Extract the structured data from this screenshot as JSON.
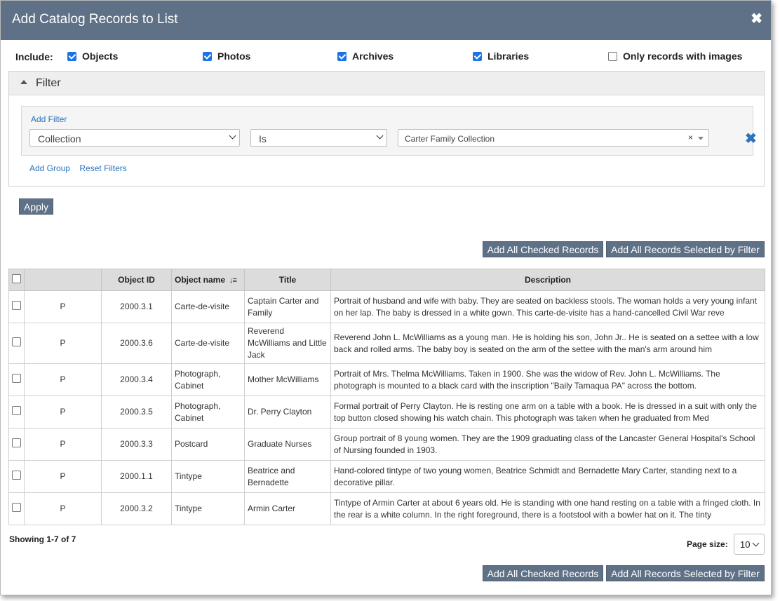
{
  "dialog": {
    "title": "Add Catalog Records to List"
  },
  "include": {
    "label": "Include:",
    "options": [
      {
        "label": "Objects",
        "checked": true
      },
      {
        "label": "Photos",
        "checked": true
      },
      {
        "label": "Archives",
        "checked": true
      },
      {
        "label": "Libraries",
        "checked": true
      },
      {
        "label": "Only records with images",
        "checked": false
      }
    ]
  },
  "filter": {
    "header": "Filter",
    "add_filter": "Add Filter",
    "field": "Collection",
    "operator": "Is",
    "value": "Carter Family Collection",
    "clear_symbol": "×",
    "add_group": "Add Group",
    "reset_filters": "Reset Filters"
  },
  "apply_label": "Apply",
  "actions": {
    "add_checked": "Add All Checked Records",
    "add_filtered": "Add All Records Selected by Filter"
  },
  "table": {
    "columns": [
      "",
      "",
      "Object ID",
      "Object name",
      "Title",
      "Description"
    ],
    "rows": [
      {
        "type": "P",
        "id": "2000.3.1",
        "name": "Carte-de-visite",
        "title": "Captain Carter and Family",
        "description": "Portrait of husband and wife with baby. They are seated on backless stools.  The woman holds a very young infant on her lap. The baby is dressed in a white gown.  This carte-de-visite has a hand-cancelled Civil War reve"
      },
      {
        "type": "P",
        "id": "2000.3.6",
        "name": "Carte-de-visite",
        "title": "Reverend McWilliams and Little Jack",
        "description": "Reverend John L. McWilliams as a young man.  He is holding his son, John Jr..  He is seated on a settee with a low back and rolled arms.  The baby boy is seated on the arm of the settee with the man's arm around him"
      },
      {
        "type": "P",
        "id": "2000.3.4",
        "name": "Photograph, Cabinet",
        "title": "Mother McWilliams",
        "description": "Portrait of Mrs. Thelma McWilliams.  Taken in 1900.  She was the widow of Rev. John L. McWilliams. The photograph is mounted to a black card with the inscription \"Baily Tamaqua PA\" across the bottom."
      },
      {
        "type": "P",
        "id": "2000.3.5",
        "name": "Photograph, Cabinet",
        "title": "Dr. Perry Clayton",
        "description": "Formal portrait of Perry Clayton.  He is resting one arm on a table with a book.  He is dressed in a suit with only the top button closed showing his watch chain.  This photograph was taken when he graduated from Med"
      },
      {
        "type": "P",
        "id": "2000.3.3",
        "name": "Postcard",
        "title": "Graduate Nurses",
        "description": "Group portrait of 8 young women. They are the 1909 graduating class of the Lancaster General Hospital's School of Nursing founded in 1903."
      },
      {
        "type": "P",
        "id": "2000.1.1",
        "name": "Tintype",
        "title": "Beatrice and Bernadette",
        "description": "Hand-colored tintype of two young women, Beatrice Schmidt and Bernadette Mary Carter, standing next to a decorative pillar."
      },
      {
        "type": "P",
        "id": "2000.3.2",
        "name": "Tintype",
        "title": "Armin Carter",
        "description": "Tintype of Armin Carter at about 6 years old.  He is standing with one hand resting on a table with a fringed cloth.  In the rear is a white column.  In the right foreground, there is a footstool with a bowler hat on it.  The tinty"
      }
    ]
  },
  "footer": {
    "showing": "Showing 1-7 of 7",
    "page_size_label": "Page size:",
    "page_size": "10"
  }
}
